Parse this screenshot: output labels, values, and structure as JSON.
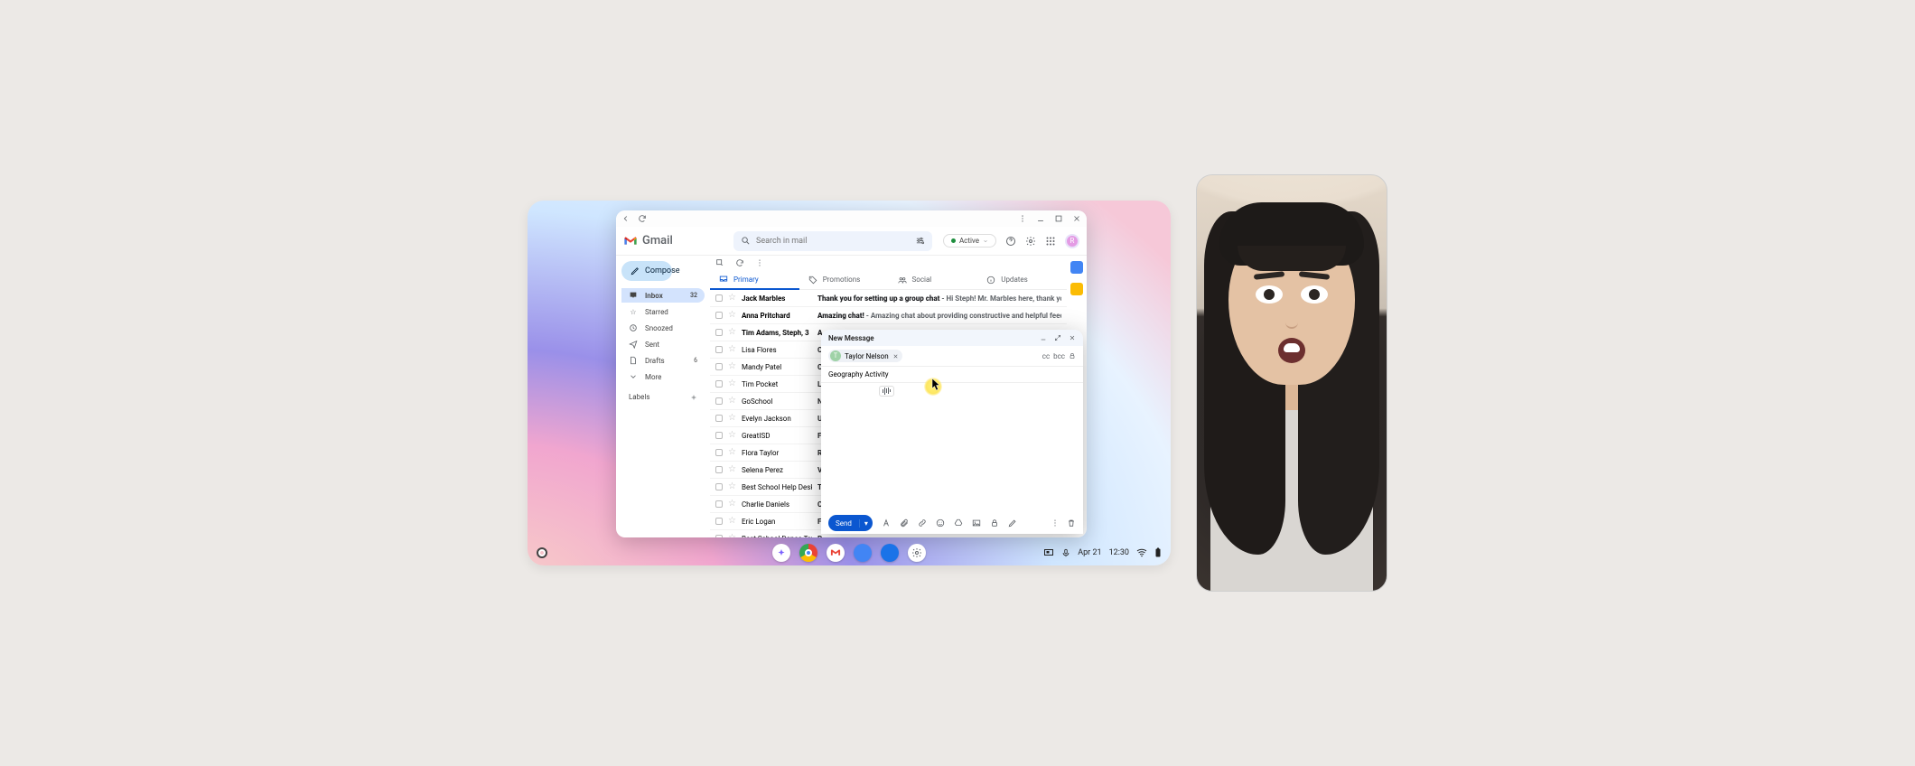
{
  "titlebar": {},
  "gmail": {
    "product": "Gmail",
    "search_placeholder": "Search in mail",
    "active_label": "Active",
    "avatar_letter": "R",
    "compose": "Compose",
    "nav": {
      "inbox": "Inbox",
      "inbox_badge": "32",
      "starred": "Starred",
      "snoozed": "Snoozed",
      "sent": "Sent",
      "drafts": "Drafts",
      "drafts_badge": "6",
      "more": "More"
    },
    "labels_title": "Labels",
    "tabs": {
      "primary": "Primary",
      "promotions": "Promotions",
      "social": "Social",
      "updates": "Updates"
    },
    "rows": [
      {
        "sender": "Jack Marbles",
        "subject": "Thank you for setting up a group chat",
        "snippet": " - Hi Steph! Mr. Marbles here, thank you for setting up a gr",
        "bold": true
      },
      {
        "sender": "Anna Pritchard",
        "subject": "Amazing chat!",
        "snippet": " - Amazing chat about providing constructive and helpful feedback! Thank you Step!",
        "bold": true
      },
      {
        "sender": "Tim Adams, Steph, 3",
        "subject": "A",
        "snippet": "",
        "bold": true
      },
      {
        "sender": "Lisa Flores",
        "subject": "C",
        "snippet": "",
        "bold": false
      },
      {
        "sender": "Mandy Patel",
        "subject": "C",
        "snippet": "",
        "bold": false
      },
      {
        "sender": "Tim Pocket",
        "subject": "L",
        "snippet": "",
        "bold": false
      },
      {
        "sender": "GoSchool",
        "subject": "N",
        "snippet": "",
        "bold": false
      },
      {
        "sender": "Evelyn Jackson",
        "subject": "U",
        "snippet": "",
        "bold": false
      },
      {
        "sender": "GreatISD",
        "subject": "F",
        "snippet": "",
        "bold": false
      },
      {
        "sender": "Flora Taylor",
        "subject": "R",
        "snippet": "",
        "bold": false
      },
      {
        "sender": "Selena Perez",
        "subject": "V",
        "snippet": "",
        "bold": false
      },
      {
        "sender": "Best School Help Desk",
        "subject": "T",
        "snippet": "",
        "bold": false
      },
      {
        "sender": "Charlie Daniels",
        "subject": "C",
        "snippet": "",
        "bold": false
      },
      {
        "sender": "Eric Logan",
        "subject": "F",
        "snippet": "",
        "bold": false
      },
      {
        "sender": "Best School Dance Troupe",
        "subject": "R",
        "snippet": "",
        "bold": false
      }
    ]
  },
  "compose_win": {
    "title": "New Message",
    "recipient": "Taylor Nelson",
    "recipient_initial": "T",
    "cc": "cc",
    "bcc": "bcc",
    "subject": "Geography Activity",
    "send": "Send"
  },
  "shelf": {
    "date": "Apr 21",
    "time": "12:30"
  }
}
